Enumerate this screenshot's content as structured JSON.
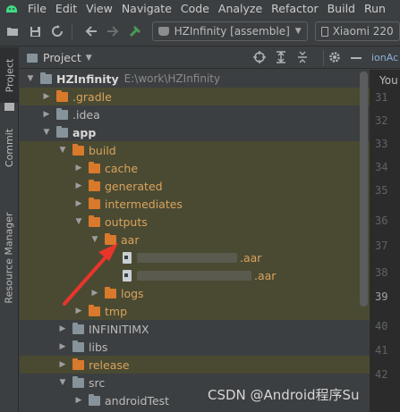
{
  "menu": {
    "items": [
      "File",
      "Edit",
      "View",
      "Navigate",
      "Code",
      "Analyze",
      "Refactor",
      "Build",
      "Run"
    ]
  },
  "toolbar": {
    "run_config": "HZInfinity [assemble]",
    "run_config_arrow": "▼",
    "device": "Xiaomi 220"
  },
  "left_strip": {
    "project": "Project",
    "commit": "Commit",
    "resource_manager": "Resource Manager"
  },
  "project_panel": {
    "title": "Project",
    "dropdown": "▼"
  },
  "tree": {
    "root": {
      "name": "HZInfinity",
      "path": "E:\\work\\HZInfinity"
    },
    "gradle": ".gradle",
    "idea": ".idea",
    "app": "app",
    "build": "build",
    "cache": "cache",
    "generated": "generated",
    "intermediates": "intermediates",
    "outputs": "outputs",
    "aar": "aar",
    "aar_file_1": ".aar",
    "aar_file_2": ".aar",
    "logs": "logs",
    "tmp": "tmp",
    "infinitimx": "INFINITIMX",
    "libs": "libs",
    "release": "release",
    "src": "src",
    "android_test": "androidTest"
  },
  "editor": {
    "tab_label": "ionAc",
    "head_text": "You",
    "line_numbers": [
      "31",
      "32",
      "33",
      "34",
      "35",
      "36",
      "37",
      "38",
      "39",
      "40",
      "41",
      "42"
    ],
    "current_line": "39"
  },
  "watermark": "CSDN @Android程序Su",
  "colors": {
    "accent_red": "#e8352b",
    "folder_orange": "#d9792b",
    "highlight_row": "#4a4a33"
  }
}
